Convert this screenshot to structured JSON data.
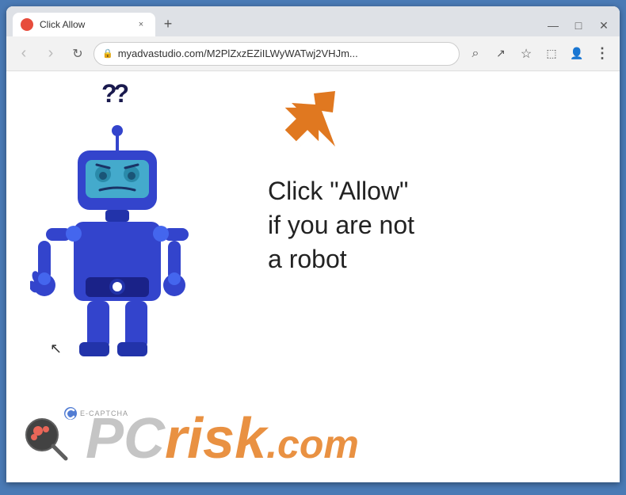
{
  "browser": {
    "tab": {
      "title": "Click Allow",
      "favicon_color": "#e74c3c",
      "close_label": "×"
    },
    "new_tab_label": "+",
    "window_controls": {
      "minimize": "—",
      "maximize": "□",
      "close": "✕"
    },
    "toolbar": {
      "back_label": "‹",
      "forward_label": "›",
      "reload_label": "↻",
      "address": "myadvastudio.com/M2PlZxzEZiILWyWATwj2VHJm...",
      "search_label": "⌕",
      "share_label": "↗",
      "bookmark_label": "☆",
      "extensions_label": "⬚",
      "profile_label": "👤",
      "menu_label": "⋮"
    }
  },
  "page": {
    "question_marks": "??",
    "main_text_line1": "Click \"Allow\"",
    "main_text_line2": "if you are not",
    "main_text_line3": "a robot",
    "ecaptcha_label": "E-CAPTCHA",
    "pcrisk_pc": "PC",
    "pcrisk_risk": "risk",
    "pcrisk_domain": ".com"
  },
  "colors": {
    "robot_blue": "#4455dd",
    "robot_dark": "#2233aa",
    "robot_visor": "#44aacc",
    "robot_body": "#3344cc",
    "arrow_orange": "#e67e22",
    "text_dark": "#1a1a1a"
  }
}
